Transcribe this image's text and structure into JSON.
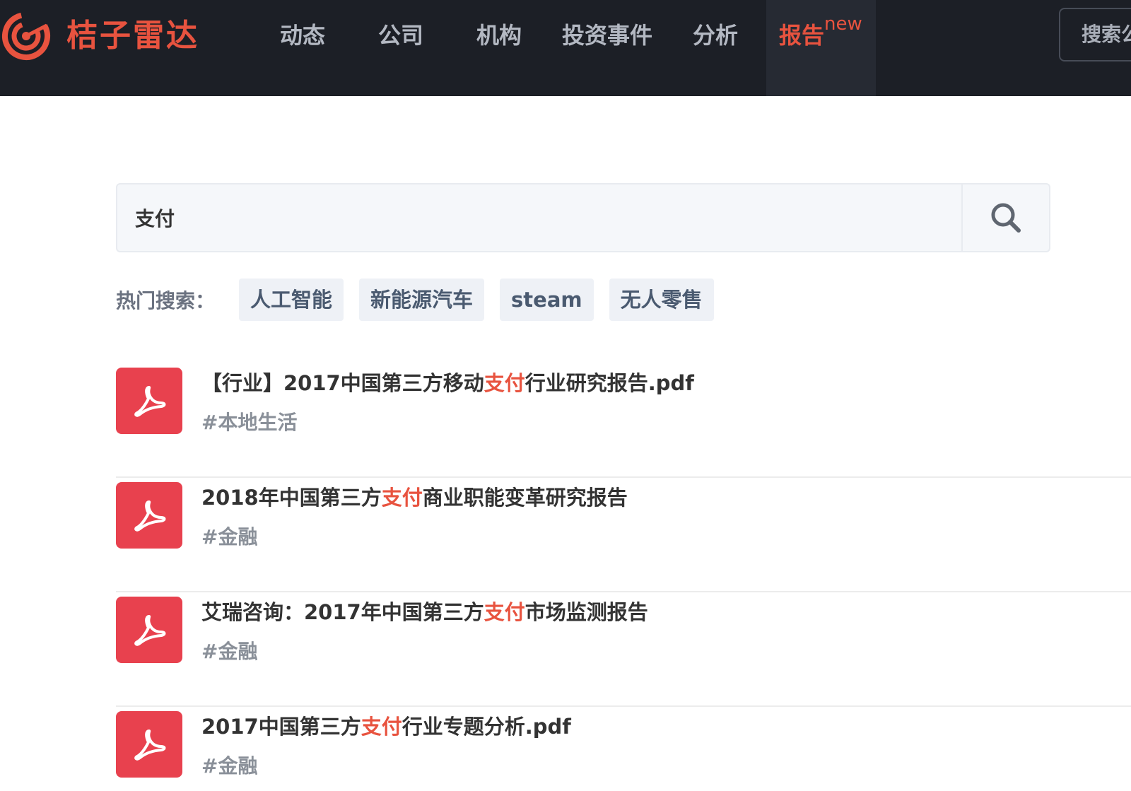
{
  "header": {
    "brand": "桔子雷达",
    "nav": [
      {
        "label": "动态"
      },
      {
        "label": "公司"
      },
      {
        "label": "机构"
      },
      {
        "label": "投资事件"
      },
      {
        "label": "分析"
      },
      {
        "label": "报告",
        "badge": "new",
        "active": true
      }
    ],
    "search_placeholder": "搜索公"
  },
  "search": {
    "query": "支付",
    "button_icon": "search-icon"
  },
  "hot_search": {
    "label": "热门搜索：",
    "tags": [
      "人工智能",
      "新能源汽车",
      "steam",
      "无人零售"
    ]
  },
  "results": [
    {
      "pre": "【行业】2017中国第三方移动",
      "highlight": "支付",
      "post": "行业研究报告.pdf",
      "tag": "#本地生活"
    },
    {
      "pre": "2018年中国第三方",
      "highlight": "支付",
      "post": "商业职能变革研究报告",
      "tag": "#金融"
    },
    {
      "pre": "艾瑞咨询：2017年中国第三方",
      "highlight": "支付",
      "post": "市场监测报告",
      "tag": "#金融"
    },
    {
      "pre": "2017中国第三方",
      "highlight": "支付",
      "post": "行业专题分析.pdf",
      "tag": "#金融"
    }
  ],
  "colors": {
    "accent": "#e8533f",
    "pdf_icon": "#e8414e",
    "topbar": "#1c1f26"
  }
}
